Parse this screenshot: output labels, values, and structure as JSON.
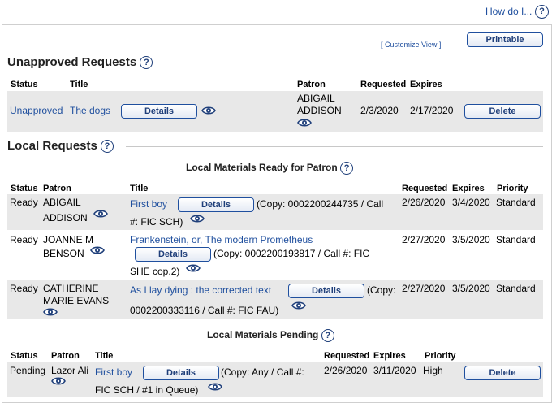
{
  "header": {
    "how_do_i": "How do I...",
    "customize_view": "[ Customize View ]",
    "printable": "Printable"
  },
  "unapproved": {
    "title": "Unapproved Requests",
    "headers": {
      "status": "Status",
      "title": "Title",
      "patron": "Patron",
      "requested": "Requested",
      "expires": "Expires"
    },
    "row": {
      "status": "Unapproved",
      "title": "The dogs",
      "details": "Details",
      "patron_line1": "ABIGAIL",
      "patron_line2": "ADDISON",
      "requested": "2/3/2020",
      "expires": "2/17/2020",
      "delete": "Delete"
    }
  },
  "local": {
    "title": "Local Requests",
    "ready_title": "Local Materials Ready for Patron",
    "headers": {
      "status": "Status",
      "patron": "Patron",
      "title": "Title",
      "requested": "Requested",
      "expires": "Expires",
      "priority": "Priority"
    },
    "rows": [
      {
        "status": "Ready",
        "patron1": "ABIGAIL",
        "patron2": "ADDISON",
        "title": "First boy",
        "details": "Details",
        "copy1": "(Copy: 0002200244735 / Call",
        "copy2": "#: FIC SCH)",
        "requested": "2/26/2020",
        "expires": "3/4/2020",
        "priority": "Standard"
      },
      {
        "status": "Ready",
        "patron1": "JOANNE M",
        "patron2": "BENSON",
        "title": "Frankenstein, or, The modern Prometheus",
        "details": "Details",
        "copy1": "(Copy: 0002200193817 / Call #: FIC",
        "copy2": "SHE cop.2)",
        "requested": "2/27/2020",
        "expires": "3/5/2020",
        "priority": "Standard"
      },
      {
        "status": "Ready",
        "patron1": "CATHERINE",
        "patron2": "MARIE EVANS",
        "title": "As I lay dying : the corrected text",
        "details": "Details",
        "copy1": "(Copy:",
        "copy2": "0002200333116 / Call #: FIC FAU)",
        "requested": "2/27/2020",
        "expires": "3/5/2020",
        "priority": "Standard"
      }
    ],
    "pending_title": "Local Materials Pending",
    "pending_headers": {
      "status": "Status",
      "patron": "Patron",
      "title": "Title",
      "requested": "Requested",
      "expires": "Expires",
      "priority": "Priority"
    },
    "pending_row": {
      "status": "Pending",
      "patron": "Lazor Ali",
      "title": "First boy",
      "details": "Details",
      "copy1": "(Copy: Any / Call #:",
      "copy2": "FIC SCH / #1 in Queue)",
      "requested": "2/26/2020",
      "expires": "3/11/2020",
      "priority": "High",
      "delete": "Delete"
    }
  },
  "icons": {
    "help": "help-icon",
    "eye": "eye-icon"
  },
  "colors": {
    "link": "#1f4f9e",
    "row_shade": "#e8e8e8",
    "button_border": "#1f4f9e"
  }
}
